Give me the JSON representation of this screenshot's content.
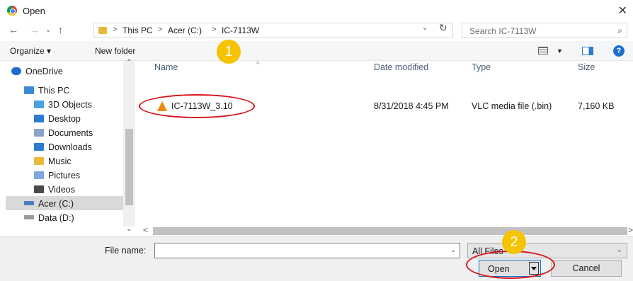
{
  "window": {
    "title": "Open",
    "close_glyph": "✕"
  },
  "nav_buttons": {
    "back": "←",
    "forward": "→",
    "recent": "⌄",
    "up": "↑"
  },
  "address": {
    "crumbs": [
      "This PC",
      "Acer (C:)",
      "IC-7113W"
    ],
    "separator": ">",
    "dropdown_glyph": "⌄",
    "refresh_glyph": "↻"
  },
  "search": {
    "placeholder": "Search IC-7113W",
    "icon": "search-icon",
    "glyph": "⌕"
  },
  "toolbar": {
    "organize": "Organize ▾",
    "new_folder": "New folder",
    "view_dd": "▼",
    "help": "?"
  },
  "nav_pane": {
    "items": [
      {
        "label": "OneDrive",
        "icon": "onedrive-icon",
        "color": "#1e6fcc"
      },
      {
        "label": "This PC",
        "icon": "computer-icon",
        "color": "#3a8bd8"
      },
      {
        "label": "3D Objects",
        "icon": "3d-objects-icon",
        "color": "#4aa3df"
      },
      {
        "label": "Desktop",
        "icon": "desktop-icon",
        "color": "#2d7bd1"
      },
      {
        "label": "Documents",
        "icon": "documents-icon",
        "color": "#8aa4c8"
      },
      {
        "label": "Downloads",
        "icon": "downloads-icon",
        "color": "#2d7bd1"
      },
      {
        "label": "Music",
        "icon": "music-icon",
        "color": "#e8b93b"
      },
      {
        "label": "Pictures",
        "icon": "pictures-icon",
        "color": "#7fa7d9"
      },
      {
        "label": "Videos",
        "icon": "videos-icon",
        "color": "#4a4a4a"
      },
      {
        "label": "Acer (C:)",
        "icon": "drive-icon",
        "color": "#4a7dbf",
        "selected": true
      },
      {
        "label": "Data (D:)",
        "icon": "drive-icon",
        "color": "#9a9a9a"
      }
    ],
    "scroll_up": "⌃",
    "scroll_down": "⌄"
  },
  "file_list": {
    "columns": {
      "name": "Name",
      "date_modified": "Date modified",
      "type": "Type",
      "size": "Size"
    },
    "sort_glyph": "^",
    "rows": [
      {
        "name": "IC-7113W_3.10",
        "date_modified": "8/31/2018 4:45 PM",
        "type": "VLC media file (.bin)",
        "size": "7,160 KB",
        "icon": "vlc-icon"
      }
    ]
  },
  "hscroll": {
    "left": "<",
    "right": ">"
  },
  "bottom": {
    "file_name_label": "File name:",
    "file_name_value": "",
    "file_name_dd": "⌄",
    "file_type": "All Files",
    "file_type_dd": "⌄",
    "open": "Open",
    "cancel": "Cancel"
  },
  "annotations": {
    "step1": "1",
    "step2": "2",
    "badge_color": "#f5c300",
    "ring_color": "#d8141c"
  }
}
